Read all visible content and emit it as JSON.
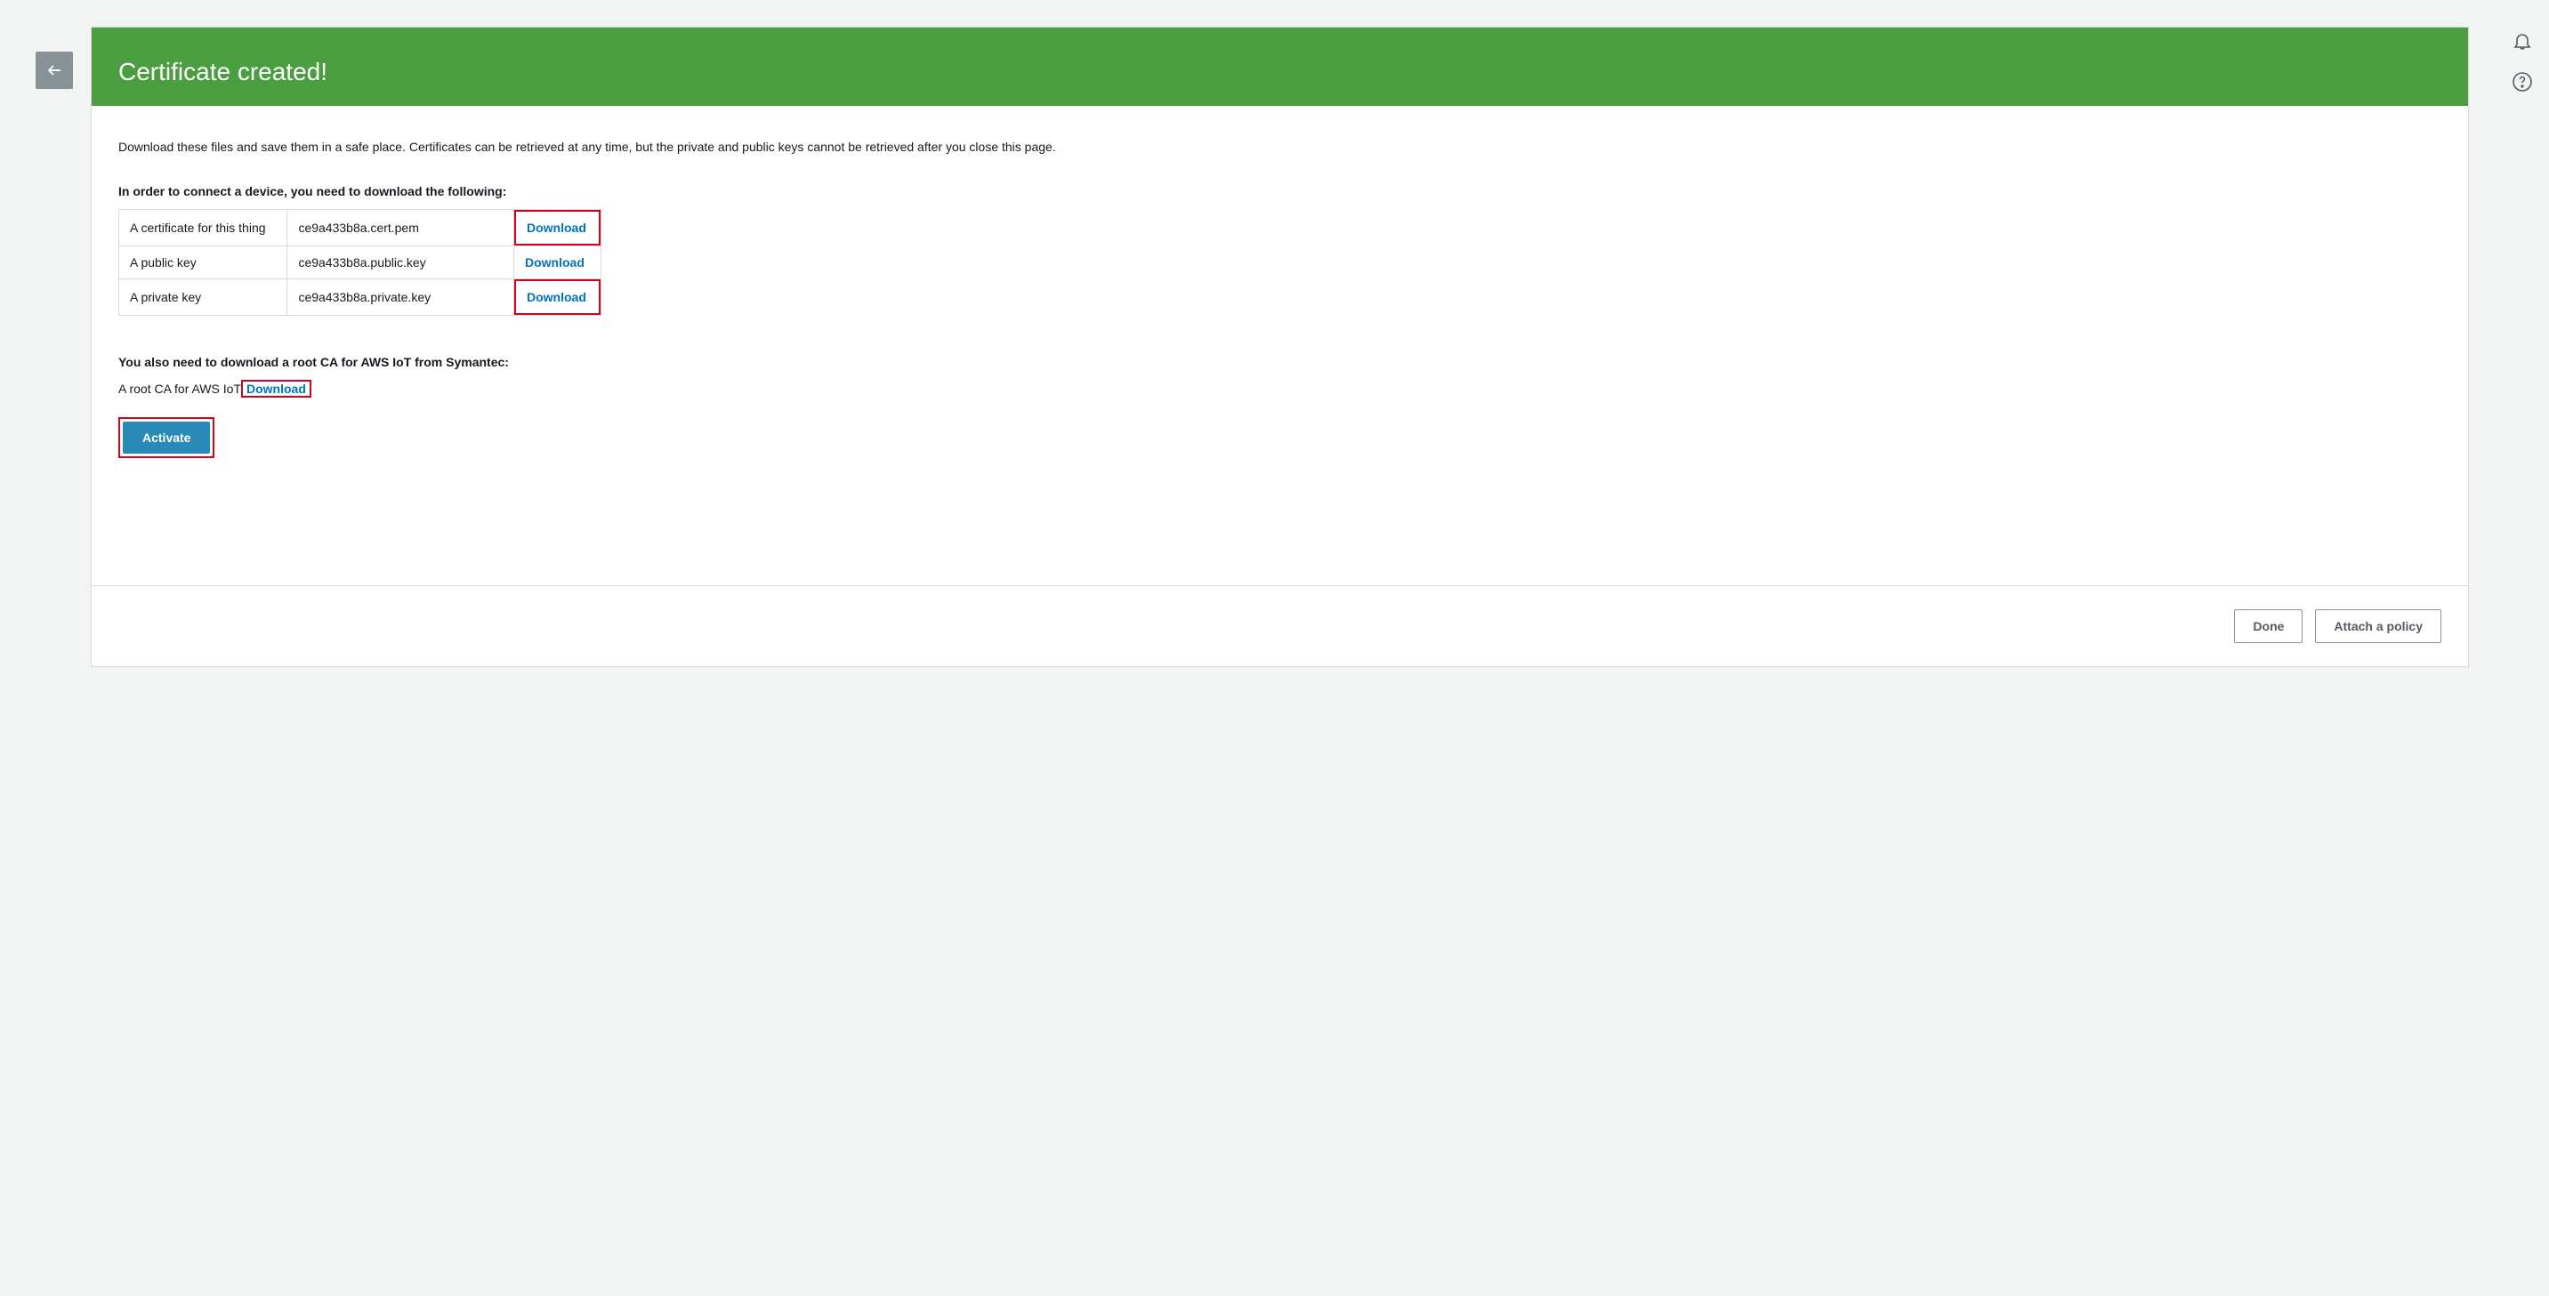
{
  "banner": {
    "title": "Certificate created!"
  },
  "content": {
    "description": "Download these files and save them in a safe place. Certificates can be retrieved at any time, but the private and public keys cannot be retrieved after you close this page.",
    "subheading": "In order to connect a device, you need to download the following:",
    "rows": [
      {
        "label": "A certificate for this thing",
        "file": "ce9a433b8a.cert.pem",
        "link": "Download",
        "highlighted": true
      },
      {
        "label": "A public key",
        "file": "ce9a433b8a.public.key",
        "link": "Download",
        "highlighted": false
      },
      {
        "label": "A private key",
        "file": "ce9a433b8a.private.key",
        "link": "Download",
        "highlighted": true
      }
    ],
    "root_heading": "You also need to download a root CA for AWS IoT from Symantec:",
    "root_line_prefix": "A root CA for AWS IoT",
    "root_link": "Download",
    "activate_label": "Activate"
  },
  "footer": {
    "done_label": "Done",
    "attach_label": "Attach a policy"
  }
}
